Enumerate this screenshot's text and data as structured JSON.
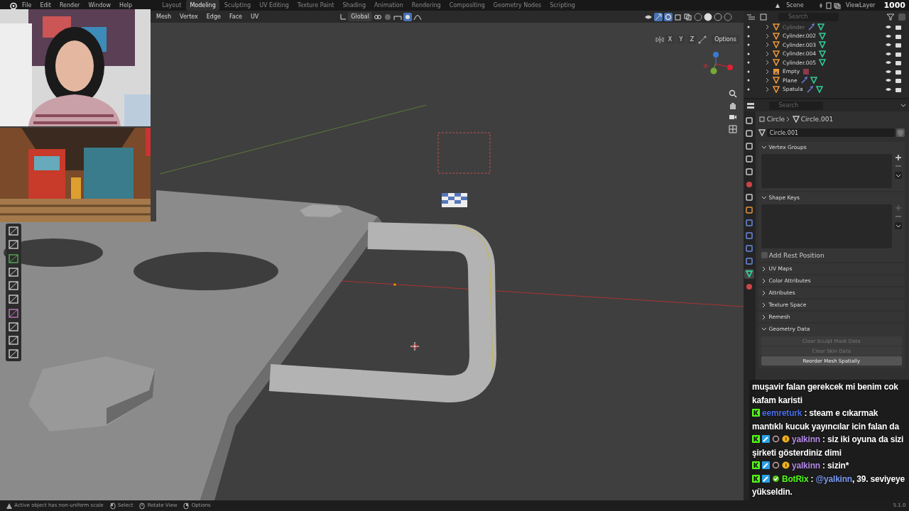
{
  "menu": [
    "File",
    "Edit",
    "Render",
    "Window",
    "Help"
  ],
  "workspaces": [
    {
      "label": "Layout",
      "selected": false
    },
    {
      "label": "Modeling",
      "selected": true
    },
    {
      "label": "Sculpting",
      "selected": false
    },
    {
      "label": "UV Editing",
      "selected": false
    },
    {
      "label": "Texture Paint",
      "selected": false
    },
    {
      "label": "Shading",
      "selected": false
    },
    {
      "label": "Animation",
      "selected": false
    },
    {
      "label": "Rendering",
      "selected": false
    },
    {
      "label": "Compositing",
      "selected": false
    },
    {
      "label": "Geometry Nodes",
      "selected": false
    },
    {
      "label": "Scripting",
      "selected": false
    }
  ],
  "scene": "Scene",
  "view_layer": "ViewLayer",
  "counter": "1000",
  "viewport": {
    "menus": [
      "Mesh",
      "Vertex",
      "Edge",
      "Face",
      "UV"
    ],
    "orientation": "Global",
    "axes": [
      "X",
      "Y",
      "Z"
    ],
    "options": "Options"
  },
  "outliner": {
    "search_placeholder": "Search",
    "items": [
      {
        "name": "Cylinder",
        "kind": "mesh",
        "modifier": true,
        "dimmed": true
      },
      {
        "name": "Cylinder.002",
        "kind": "mesh",
        "modifier": false,
        "dimmed": false
      },
      {
        "name": "Cylinder.003",
        "kind": "mesh",
        "modifier": false,
        "dimmed": false
      },
      {
        "name": "Cylinder.004",
        "kind": "mesh",
        "modifier": false,
        "dimmed": false
      },
      {
        "name": "Cylinder.005",
        "kind": "mesh",
        "modifier": false,
        "dimmed": false
      },
      {
        "name": "Empty",
        "kind": "empty",
        "modifier": false,
        "dimmed": false
      },
      {
        "name": "Plane",
        "kind": "mesh",
        "modifier": true,
        "dimmed": false
      },
      {
        "name": "Spatula",
        "kind": "mesh",
        "modifier": true,
        "dimmed": false
      }
    ]
  },
  "properties": {
    "search_placeholder": "Search",
    "tabs": [
      {
        "kind": "tool",
        "selected": false
      },
      {
        "kind": "render",
        "selected": false
      },
      {
        "kind": "output",
        "selected": false
      },
      {
        "kind": "view",
        "selected": false
      },
      {
        "kind": "scene",
        "selected": false
      },
      {
        "kind": "world",
        "selected": false
      },
      {
        "kind": "collection",
        "selected": false
      },
      {
        "kind": "object",
        "selected": false
      },
      {
        "kind": "modifier",
        "selected": false
      },
      {
        "kind": "particles",
        "selected": false
      },
      {
        "kind": "physics",
        "selected": false
      },
      {
        "kind": "constraints",
        "selected": false
      },
      {
        "kind": "data",
        "selected": true
      },
      {
        "kind": "material",
        "selected": false
      }
    ],
    "breadcrumb": [
      "Circle",
      "Circle.001"
    ],
    "data_name": "Circle.001",
    "panels": [
      {
        "title": "Vertex Groups",
        "expanded": true,
        "kind": "list",
        "add_enabled": true
      },
      {
        "title": "Shape Keys",
        "expanded": true,
        "kind": "list",
        "add_enabled": false,
        "checkbox": {
          "label": "Add Rest Position",
          "checked": false
        }
      },
      {
        "title": "UV Maps",
        "expanded": false
      },
      {
        "title": "Color Attributes",
        "expanded": false
      },
      {
        "title": "Attributes",
        "expanded": false
      },
      {
        "title": "Texture Space",
        "expanded": false
      },
      {
        "title": "Remesh",
        "expanded": false
      },
      {
        "title": "Geometry Data",
        "expanded": true,
        "kind": "buttons",
        "buttons": [
          {
            "label": "Clear Sculpt Mask Data",
            "disabled": true
          },
          {
            "label": "Clear Skin Data",
            "disabled": true
          },
          {
            "label": "Reorder Mesh Spatially",
            "disabled": false
          }
        ]
      }
    ]
  },
  "chat": [
    {
      "text": "muşavir falan gerekcek mi benim cok kafam karisti"
    },
    {
      "user": "eemreturk",
      "color": "#4a6ee8",
      "badges": [
        {
          "kind": "kick"
        }
      ],
      "text": ": steam e cıkarmak mantıklı kucuk yayıncılar icin falan da"
    },
    {
      "user": "yalkinn",
      "color": "#b58be8",
      "badges": [
        {
          "kind": "kick"
        },
        {
          "kind": "tool"
        },
        {
          "kind": "emblem"
        },
        {
          "kind": "coin"
        }
      ],
      "text": ": siz iki oyuna da sizi şirketi gösterdiniz dimi"
    },
    {
      "user": "yalkinn",
      "color": "#b58be8",
      "badges": [
        {
          "kind": "kick"
        },
        {
          "kind": "tool"
        },
        {
          "kind": "emblem"
        },
        {
          "kind": "coin"
        }
      ],
      "text": ": sizin*"
    },
    {
      "user": "BotRix",
      "color": "#53fc18",
      "badges": [
        {
          "kind": "kick"
        },
        {
          "kind": "tool"
        },
        {
          "kind": "verified"
        }
      ],
      "text": ":",
      "mention": "@yalkinn",
      "rest": ", 39. seviyeye yükseldin."
    }
  ],
  "status_bar": {
    "hints": [
      {
        "kind": "warning",
        "text": "Active object has non-uniform scale"
      },
      {
        "kind": "mouse-left",
        "text": "Select"
      },
      {
        "kind": "mouse-middle",
        "text": "Rotate View"
      },
      {
        "kind": "mouse-right",
        "text": "Options"
      }
    ],
    "version": "5.1.0"
  }
}
